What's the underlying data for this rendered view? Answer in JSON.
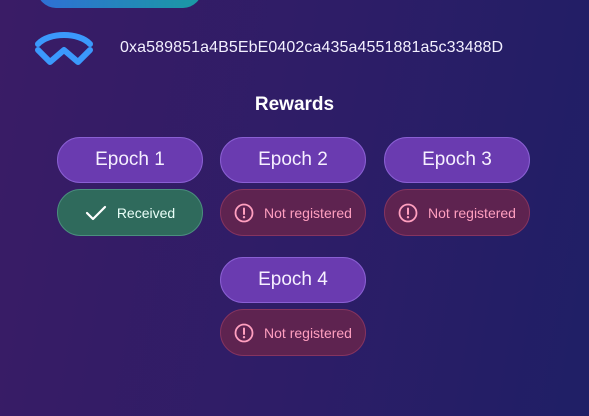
{
  "header": {
    "wallet_icon": "walletconnect-icon",
    "address": "0xa589851a4B5EbE0402ca435a4551881a5c33488D"
  },
  "rewards": {
    "title": "Rewards",
    "epochs": [
      {
        "label": "Epoch 1",
        "status": "Received",
        "status_icon": "check-icon"
      },
      {
        "label": "Epoch 2",
        "status": "Not registered",
        "status_icon": "alert-circle-icon"
      },
      {
        "label": "Epoch 3",
        "status": "Not registered",
        "status_icon": "alert-circle-icon"
      },
      {
        "label": "Epoch 4",
        "status": "Not registered",
        "status_icon": "alert-circle-icon"
      }
    ]
  },
  "colors": {
    "epoch_button": "#6a3bb0",
    "received_bg": "#2f6a5c",
    "not_registered_bg": "#5e2350",
    "not_registered_text": "#ff9fbf",
    "walletconnect_blue": "#3b99fc"
  }
}
